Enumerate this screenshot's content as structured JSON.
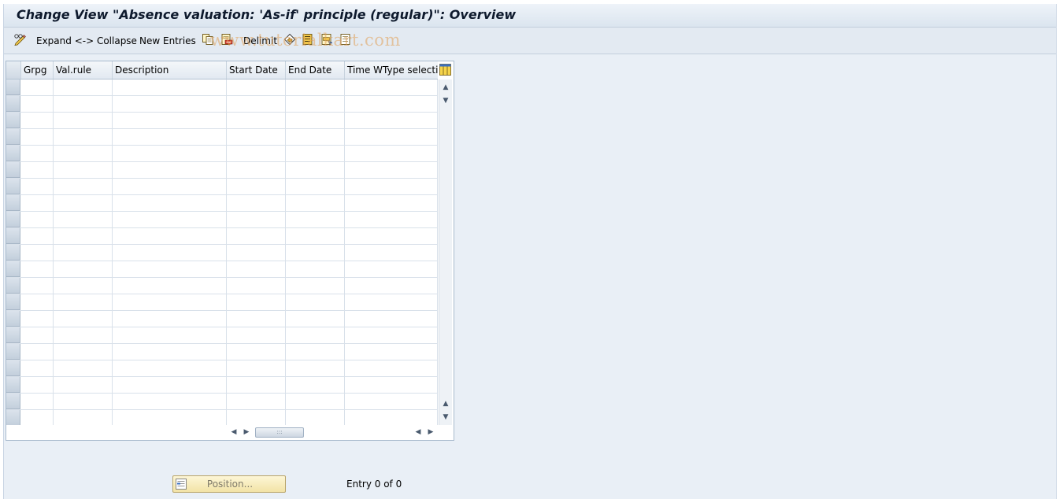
{
  "window": {
    "title": "Change View \"Absence valuation: 'As-if' principle (regular)\": Overview"
  },
  "toolbar": {
    "edit_icon": "pencil-glasses-icon",
    "expand_collapse_label": "Expand <-> Collapse",
    "new_entries_label": "New Entries",
    "copy_icon": "copy-icon",
    "delete_icon": "delete-icon",
    "delimit_label": "Delimit",
    "undo_icon": "undo-change-icon",
    "select_all_icon": "select-all-icon",
    "select_block_icon": "select-block-icon",
    "deselect_all_icon": "deselect-all-icon",
    "watermark": "www.tutorialkart.com"
  },
  "table": {
    "columns": [
      {
        "key": "grpg",
        "label": "Grpg"
      },
      {
        "key": "val_rule",
        "label": "Val.rule"
      },
      {
        "key": "description",
        "label": "Description"
      },
      {
        "key": "start_date",
        "label": "Start Date"
      },
      {
        "key": "end_date",
        "label": "End Date"
      },
      {
        "key": "time_wtype",
        "label": "Time WType selectio"
      }
    ],
    "rows": [],
    "config_icon": "table-settings-icon",
    "scroll_up_icon": "arrow-up-icon",
    "scroll_down_icon": "arrow-down-icon",
    "scroll_left_icon": "arrow-left-icon",
    "scroll_right_icon": "arrow-right-icon"
  },
  "footer": {
    "position_label": "Position...",
    "position_icon": "position-icon",
    "entry_text": "Entry 0 of 0"
  },
  "colors": {
    "background": "#e9eff6",
    "title_text": "#0e1a2d",
    "position_button": "#f7ecbf",
    "watermark": "#e2a05a"
  }
}
